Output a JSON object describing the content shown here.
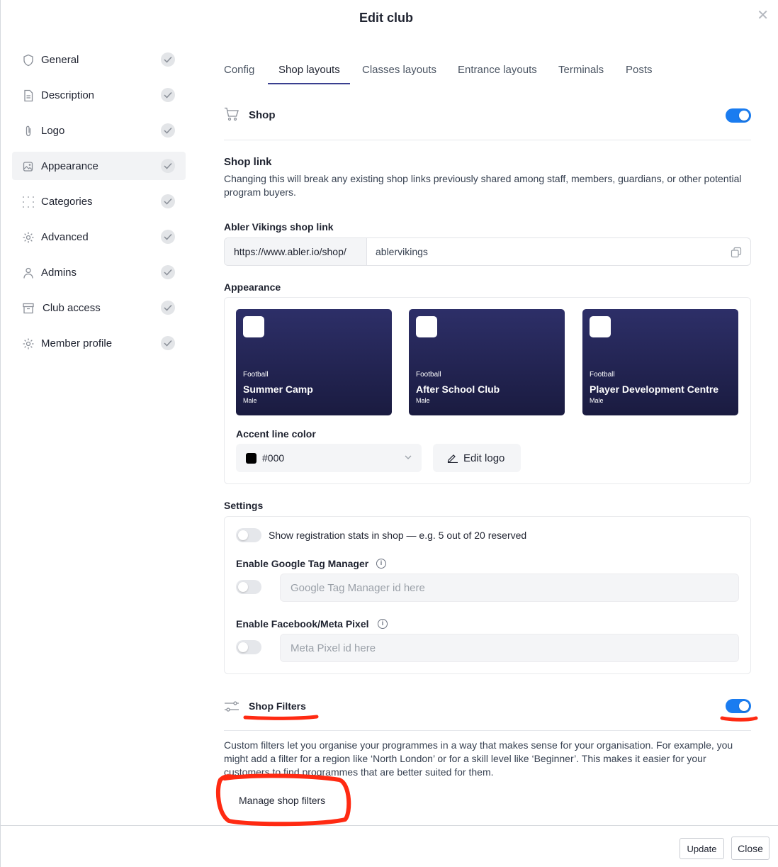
{
  "modal": {
    "title": "Edit club"
  },
  "sidebar": {
    "items": [
      {
        "label": "General",
        "icon": "shield-icon"
      },
      {
        "label": "Description",
        "icon": "document-icon"
      },
      {
        "label": "Logo",
        "icon": "paperclip-icon"
      },
      {
        "label": "Appearance",
        "icon": "image-edit-icon",
        "active": true
      },
      {
        "label": "Categories",
        "icon": "grid-dots-icon"
      },
      {
        "label": "Advanced",
        "icon": "gear-icon"
      },
      {
        "label": "Admins",
        "icon": "user-icon"
      },
      {
        "label": "Club access",
        "icon": "archive-box-icon"
      },
      {
        "label": "Member profile",
        "icon": "gear-icon"
      }
    ]
  },
  "tabs": [
    "Config",
    "Shop layouts",
    "Classes layouts",
    "Entrance layouts",
    "Terminals",
    "Posts"
  ],
  "active_tab": "Shop layouts",
  "shop": {
    "title": "Shop",
    "enabled": true,
    "link_heading": "Shop link",
    "link_warning": "Changing this will break any existing shop links previously shared among staff, members, guardians, or other potential program buyers.",
    "link_label": "Abler Vikings shop link",
    "link_prefix": "https://www.abler.io/shop/",
    "link_value": "ablervikings"
  },
  "appearance": {
    "heading": "Appearance",
    "cards": [
      {
        "category": "Football",
        "name": "Summer Camp",
        "gender": "Male"
      },
      {
        "category": "Football",
        "name": "After School Club",
        "gender": "Male"
      },
      {
        "category": "Football",
        "name": "Player Development Centre",
        "gender": "Male"
      }
    ],
    "accent_label": "Accent line color",
    "accent_value": "#000",
    "edit_logo": "Edit logo"
  },
  "settings": {
    "heading": "Settings",
    "stats_label": "Show registration stats in shop — e.g. 5 out of 20 reserved",
    "stats_enabled": false,
    "gtm_label": "Enable Google Tag Manager",
    "gtm_enabled": false,
    "gtm_placeholder": "Google Tag Manager id here",
    "pixel_label": "Enable Facebook/Meta Pixel",
    "pixel_enabled": false,
    "pixel_placeholder": "Meta Pixel id here"
  },
  "filters": {
    "title": "Shop Filters",
    "enabled": true,
    "description": "Custom filters let you organise your programmes in a way that makes sense for your organisation. For example, you might add a filter for a region like ‘North London’ or for a skill level like ‘Beginner’. This makes it easier for your customers to find programmes that are better suited for them.",
    "manage_button": "Manage shop filters"
  },
  "footer": {
    "update": "Update",
    "close": "Close"
  },
  "colors": {
    "accent": "#1a7cf0",
    "card_bg": "#23244f",
    "annotation": "#ff2a12"
  }
}
